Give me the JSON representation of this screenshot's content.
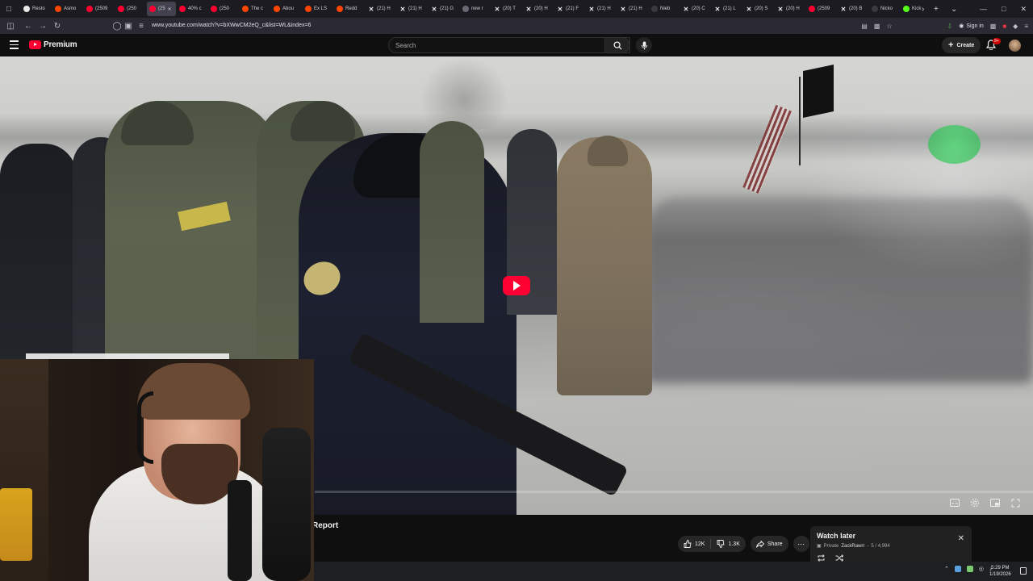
{
  "browser": {
    "tabs": [
      {
        "favicon": "github-icon",
        "label": "Resto"
      },
      {
        "favicon": "reddit-icon",
        "label": "Asmo"
      },
      {
        "favicon": "youtube-icon",
        "label": "(2509"
      },
      {
        "favicon": "youtube-icon",
        "label": "(250"
      },
      {
        "favicon": "youtube-icon",
        "label": "(25",
        "active": true
      },
      {
        "favicon": "youtube-icon",
        "label": "40% c"
      },
      {
        "favicon": "youtube-icon",
        "label": "(250"
      },
      {
        "favicon": "reddit-icon",
        "label": "The c"
      },
      {
        "favicon": "reddit-icon",
        "label": "Abou"
      },
      {
        "favicon": "reddit-icon",
        "label": "Ex LS"
      },
      {
        "favicon": "reddit-icon",
        "label": "Redd"
      },
      {
        "favicon": "x-icon",
        "label": "(21) H"
      },
      {
        "favicon": "x-icon",
        "label": "(21) H"
      },
      {
        "favicon": "x-icon",
        "label": "(21) G"
      },
      {
        "favicon": "globe-icon",
        "label": "new r"
      },
      {
        "favicon": "x-icon",
        "label": "(20) T"
      },
      {
        "favicon": "x-icon",
        "label": "(20) H"
      },
      {
        "favicon": "x-icon",
        "label": "(21) F"
      },
      {
        "favicon": "x-icon",
        "label": "(21) H"
      },
      {
        "favicon": "x-icon",
        "label": "(21) H"
      },
      {
        "favicon": "nico-icon",
        "label": "Nieb"
      },
      {
        "favicon": "x-icon",
        "label": "(20) C"
      },
      {
        "favicon": "x-icon",
        "label": "(21) L"
      },
      {
        "favicon": "x-icon",
        "label": "(20) S"
      },
      {
        "favicon": "x-icon",
        "label": "(20) H"
      },
      {
        "favicon": "youtube-icon",
        "label": "(2509"
      },
      {
        "favicon": "x-icon",
        "label": "(20) B"
      },
      {
        "favicon": "nico-icon",
        "label": "Nicko"
      },
      {
        "favicon": "kick-icon",
        "label": "Kick"
      }
    ],
    "url": "www.youtube.com/watch?v=bXWwCM2eQ_c&list=WL&index=6",
    "signin_label": "Sign in"
  },
  "youtube": {
    "logo_text": "Premium",
    "search_placeholder": "Search",
    "create_label": "Create",
    "notification_count": "9+",
    "video": {
      "progress": 0.0
    },
    "report_label": "Report",
    "like_count": "12K",
    "dislike_count": "1.3K",
    "share_label": "Share",
    "watch_later": {
      "title": "Watch later",
      "privacy": "Private",
      "owner": "ZackRawrr",
      "position": "5 / 4,994"
    }
  },
  "taskbar": {
    "time": "5:29 PM",
    "date": "1/19/2026"
  },
  "colors": {
    "youtube_red": "#ff0033",
    "background": "#0f0f0f",
    "pill_bg": "#272727"
  }
}
